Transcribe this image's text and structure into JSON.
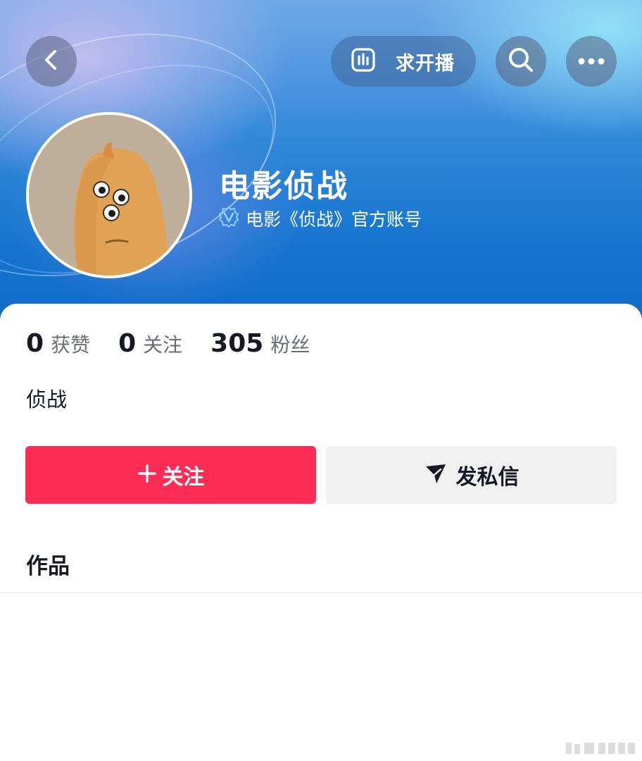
{
  "header": {
    "live_request_label": "求开播",
    "back_icon": "chevron-left-icon",
    "live_icon": "bar-chart-icon",
    "search_icon": "search-icon",
    "more_icon": "more-dots-icon"
  },
  "profile": {
    "username": "电影侦战",
    "verification": "电影《侦战》官方账号",
    "verify_icon": "verified-v-icon"
  },
  "stats": [
    {
      "value": "0",
      "label": "获赞"
    },
    {
      "value": "0",
      "label": "关注"
    },
    {
      "value": "305",
      "label": "粉丝"
    }
  ],
  "bio": "侦战",
  "actions": {
    "follow_label": "关注",
    "message_label": "发私信"
  },
  "tabs": {
    "works_label": "作品"
  },
  "colors": {
    "follow_button": "#fe2c55",
    "message_button": "#f1f1f2",
    "header_blue": "#1574cf"
  }
}
